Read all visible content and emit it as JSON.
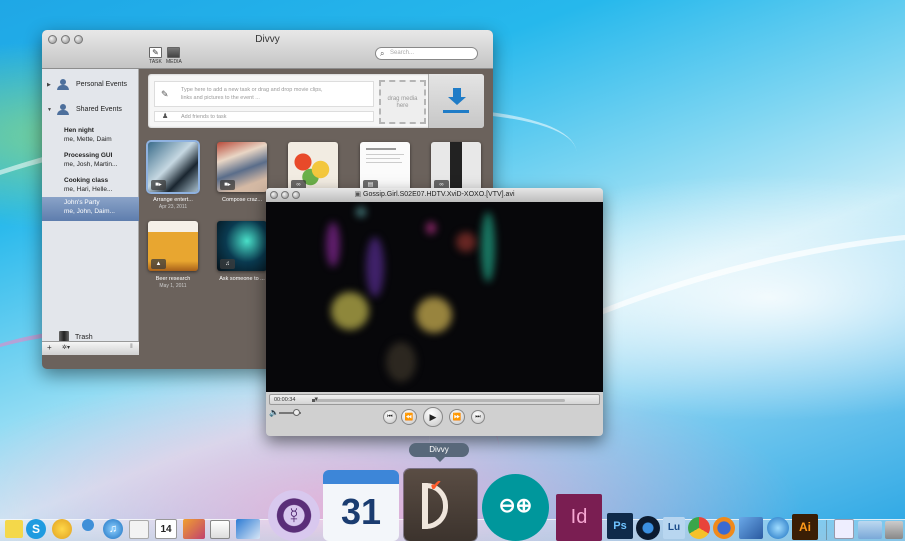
{
  "divvy": {
    "title": "Divvy",
    "toolbar": {
      "task_label": "TASK",
      "media_label": "MEDIA"
    },
    "search_placeholder": "Search...",
    "sidebar": {
      "personal_events": "Personal Events",
      "shared_events": "Shared Events",
      "events": [
        {
          "name": "Hen night",
          "people": "me, Mette, Daim"
        },
        {
          "name": "Processing GUI",
          "people": "me, Josh, Martin..."
        },
        {
          "name": "Cooking class",
          "people": "me, Hari, Helle..."
        },
        {
          "name": "John's Party",
          "people": "me, John, Daim..."
        }
      ],
      "trash": "Trash",
      "add_button": "+",
      "gear_button": "✲▾",
      "resize_handle": "⦀"
    },
    "task_input": {
      "placeholder_line1": "Type here to add a new task or drag and drop movie clips,",
      "placeholder_line2": "links and pictures to the event ...",
      "friends_placeholder": "Add friends to task",
      "drop_zone": "drag media here"
    },
    "media_items": [
      {
        "caption": "Arrange entert...",
        "date": "Apr 23, 2011",
        "kind": "video"
      },
      {
        "caption": "Compose craz...",
        "date": "",
        "kind": "video"
      },
      {
        "caption": "",
        "date": "",
        "kind": "link"
      },
      {
        "caption": "",
        "date": "",
        "kind": "document"
      },
      {
        "caption": "",
        "date": "",
        "kind": "link"
      },
      {
        "caption": "Beer research",
        "date": "May 1, 2011",
        "kind": "image"
      },
      {
        "caption": "Ask someone to ...",
        "date": "",
        "kind": "audio"
      }
    ]
  },
  "video_player": {
    "title": "Gossip.Girl.S02E07.HDTV.XviD-XOXO.[VTV].avi",
    "time": "00:00:34",
    "progress": 0.01,
    "volume": 0.75,
    "buttons": {
      "prev": "⏮",
      "rewind": "⏪",
      "play": "▶",
      "forward": "⏩",
      "next": "⏭"
    }
  },
  "dock": {
    "tooltip": "Divvy",
    "calendar_day": "31",
    "indesign_label": "Id",
    "photoshop_label": "Ps",
    "illustrator_label": "Ai"
  }
}
